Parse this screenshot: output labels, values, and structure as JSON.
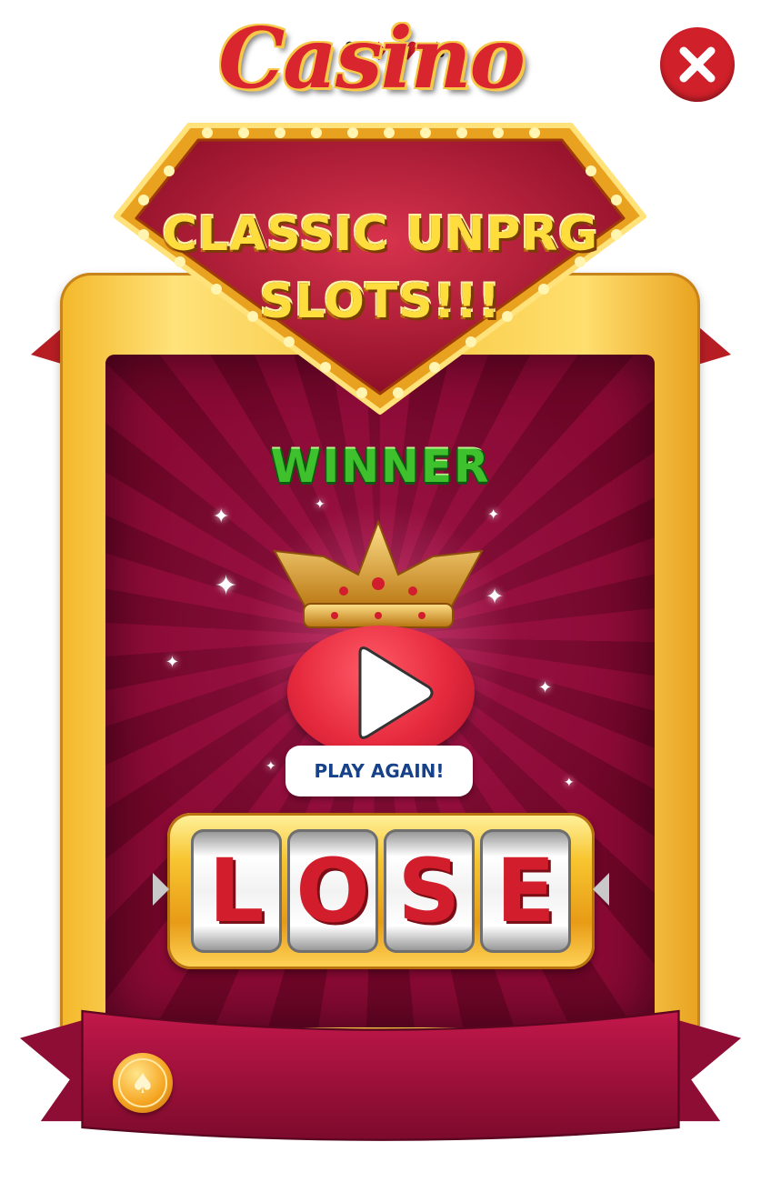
{
  "logo": {
    "text": "Casino"
  },
  "sign": {
    "line1": "CLASSIC UNPRG",
    "line2": "SLOTS!!!"
  },
  "result": {
    "label": "WINNER"
  },
  "play_again": {
    "label": "PLAY AGAIN!"
  },
  "slot": {
    "reels": [
      "L",
      "O",
      "S",
      "E"
    ]
  },
  "icons": {
    "close": "close-icon",
    "play": "play-icon",
    "crown": "crown-icon",
    "coin": "spade-coin-icon",
    "suits": "card-suits-icon"
  },
  "colors": {
    "sign_red": "#c0223a",
    "gold": "#f6c53c",
    "title_yellow": "#ffdd3c",
    "winner_green": "#3fc12e",
    "play_red": "#e62a3e",
    "play_text_blue": "#17428a",
    "close_red": "#d0202a",
    "panel_magenta": "#8a0a35"
  }
}
